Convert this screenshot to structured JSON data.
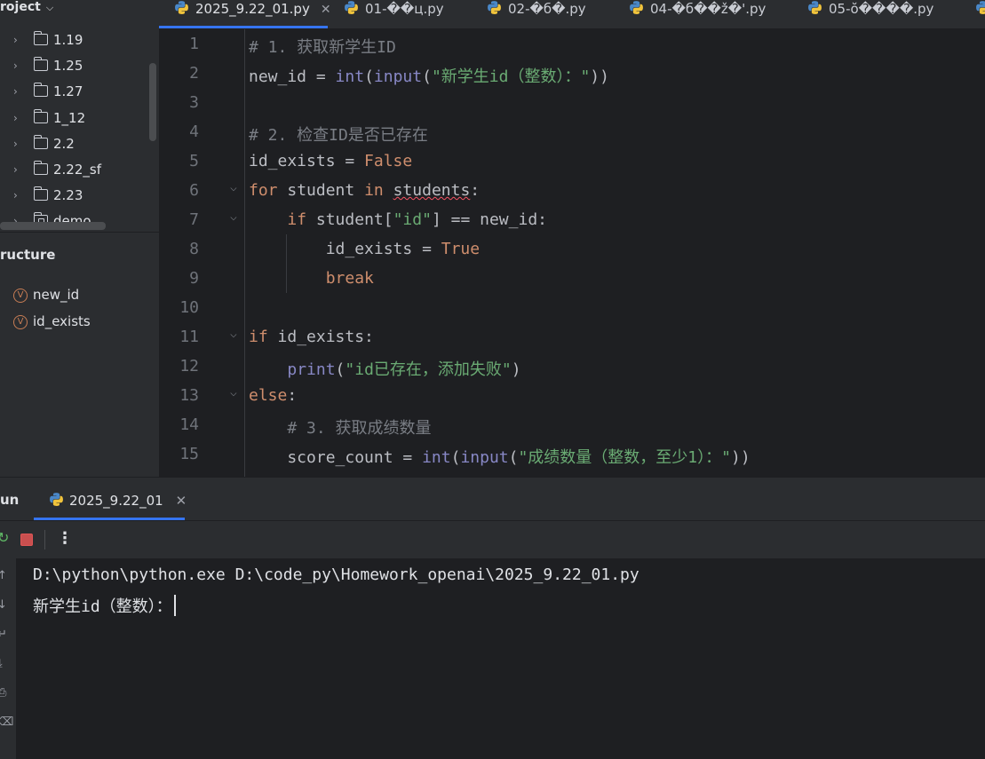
{
  "project": {
    "header": "roject",
    "folders": [
      "1.19",
      "1.25",
      "1.27",
      "1_12",
      "2.2",
      "2.22_sf",
      "2.23",
      "demo"
    ]
  },
  "structure": {
    "header": "ructure",
    "items": [
      {
        "badge": "V",
        "label": "new_id"
      },
      {
        "badge": "V",
        "label": "id_exists"
      }
    ]
  },
  "tabs": [
    {
      "label": "2025_9.22_01.py",
      "close": "✕"
    },
    {
      "label": "01-��ц.py"
    },
    {
      "label": "02-�б�.py"
    },
    {
      "label": "04-�б��ž�'.py"
    },
    {
      "label": "05-ŏ����.py"
    }
  ],
  "editor": {
    "lines": [
      {
        "n": "1",
        "t": "# 1. 获取新学生ID"
      },
      {
        "n": "2",
        "t": "new_id = int(input(\"新学生id（整数）：\"))"
      },
      {
        "n": "3",
        "t": ""
      },
      {
        "n": "4",
        "t": "# 2. 检查ID是否已存在"
      },
      {
        "n": "5",
        "t": "id_exists = False"
      },
      {
        "n": "6",
        "t": "for student in students:"
      },
      {
        "n": "7",
        "t": "    if student[\"id\"] == new_id:"
      },
      {
        "n": "8",
        "t": "        id_exists = True"
      },
      {
        "n": "9",
        "t": "        break"
      },
      {
        "n": "10",
        "t": ""
      },
      {
        "n": "11",
        "t": "if id_exists:"
      },
      {
        "n": "12",
        "t": "    print(\"id已存在，添加失败\")"
      },
      {
        "n": "13",
        "t": "else:"
      },
      {
        "n": "14",
        "t": "    # 3. 获取成绩数量"
      },
      {
        "n": "15",
        "t": "    score_count = int(input(\"成绩数量（整数，至少1）：\"))"
      }
    ],
    "tokens": {
      "l1": "# 1. 获取新学生ID",
      "l2a": "new_id = ",
      "l2b": "int",
      "l2c": "(",
      "l2d": "input",
      "l2e": "(",
      "l2f": "\"新学生id（整数）：\"",
      "l2g": "))",
      "l4": "# 2. 检查ID是否已存在",
      "l5a": "id_exists = ",
      "l5b": "False",
      "l6a": "for",
      "l6b": " student ",
      "l6c": "in",
      "l6d": " ",
      "l6e": "students",
      "l6f": ":",
      "l7a": "    ",
      "l7b": "if",
      "l7c": " student[",
      "l7d": "\"id\"",
      "l7e": "] == new_id:",
      "l8a": "        id_exists = ",
      "l8b": "True",
      "l9a": "        ",
      "l9b": "break",
      "l11a": "if",
      "l11b": " id_exists:",
      "l12a": "    ",
      "l12b": "print",
      "l12c": "(",
      "l12d": "\"id已存在，添加失败\"",
      "l12e": ")",
      "l13a": "else",
      "l13b": ":",
      "l14a": "    ",
      "l14b": "# 3. 获取成绩数量",
      "l15a": "    score_count = ",
      "l15b": "int",
      "l15c": "(",
      "l15d": "input",
      "l15e": "(",
      "l15f": "\"成绩数量（整数，至少1）：\"",
      "l15g": "))"
    }
  },
  "run": {
    "title": "un",
    "tab_label": "2025_9.22_01",
    "tab_close": "✕",
    "more": "⋮",
    "console": [
      "D:\\python\\python.exe D:\\code_py\\Homework_openai\\2025_9.22_01.py",
      "新学生id（整数）："
    ]
  },
  "colors": {
    "background": "#1e1f22",
    "panel": "#2b2d30",
    "accent": "#3574f0",
    "keyword": "#cf8e6d",
    "string": "#6aab73",
    "builtin": "#8888c6",
    "comment": "#7a7e85"
  },
  "icons": [
    "python-file-icon",
    "folder-icon",
    "variable-icon",
    "stop-icon",
    "rerun-icon",
    "more-icon",
    "fold-icon"
  ]
}
